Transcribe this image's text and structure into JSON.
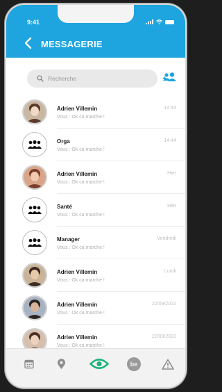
{
  "status_bar": {
    "time": "9:41"
  },
  "header": {
    "title": "MESSAGERIE"
  },
  "search": {
    "placeholder": "Recherche"
  },
  "conversations": [
    {
      "name": "Adrien Villemin",
      "last_message": "Vous : Ok ca marche !",
      "date": "14:44",
      "avatar": "photo"
    },
    {
      "name": "Orga",
      "last_message": "Vous : Ok ca marche !",
      "date": "14:44",
      "avatar": "group"
    },
    {
      "name": "Adrien Villemin",
      "last_message": "Vous : Ok ca marche !",
      "date": "Hier",
      "avatar": "photo"
    },
    {
      "name": "Santé",
      "last_message": "Vous : Ok ca marche !",
      "date": "Hier",
      "avatar": "group"
    },
    {
      "name": "Manager",
      "last_message": "Vous : Ok ca marche !",
      "date": "Vendredi",
      "avatar": "group"
    },
    {
      "name": "Adrien Villemin",
      "last_message": "Vous : Ok ca marche !",
      "date": "Lundi",
      "avatar": "photo"
    },
    {
      "name": "Adrien Villemin",
      "last_message": "Vous : Ok ca marche !",
      "date": "22/09/2022",
      "avatar": "photo"
    },
    {
      "name": "Adrien Villemin",
      "last_message": "Vous : Ok ca marche !",
      "date": "22/09/2022",
      "avatar": "photo"
    }
  ],
  "tab_bar": {
    "items": [
      {
        "icon": "calendar-icon",
        "active": false
      },
      {
        "icon": "location-pin-icon",
        "active": false
      },
      {
        "icon": "eye-icon",
        "active": true
      },
      {
        "icon": "be-logo-icon",
        "active": false
      },
      {
        "icon": "warning-icon",
        "active": false
      }
    ]
  },
  "colors": {
    "header": "#1ea4de",
    "active_tab": "#19b37a",
    "inactive_tab": "#8d8d8d"
  }
}
